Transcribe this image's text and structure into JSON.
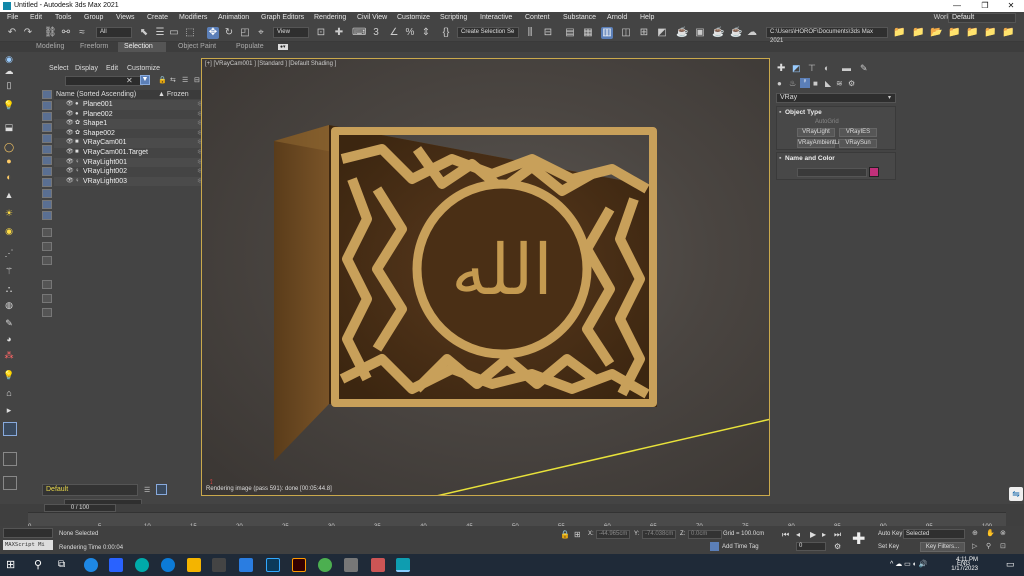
{
  "window": {
    "title": "Untitled - Autodesk 3ds Max 2021",
    "minimize": "—",
    "restore": "❐",
    "close": "✕"
  },
  "menu": [
    "File",
    "Edit",
    "Tools",
    "Group",
    "Views",
    "Create",
    "Modifiers",
    "Animation",
    "Graph Editors",
    "Rendering",
    "Civil View",
    "Customize",
    "Scripting",
    "Interactive",
    "Content",
    "Substance",
    "Arnold",
    "Help"
  ],
  "workspaces": {
    "label": "Workspaces:",
    "value": "Default"
  },
  "toolbar": {
    "filter": "All",
    "refcoord": "View",
    "selset": "Create Selection Se",
    "path": "C:\\Users\\HOROF\\Documents\\3ds Max 2021"
  },
  "ribbon": [
    "Modeling",
    "Freeform",
    "Selection",
    "Object Paint",
    "Populate"
  ],
  "scene": {
    "tabs": [
      "Select",
      "Display",
      "Edit",
      "Customize"
    ],
    "col_name": "Name (Sorted Ascending)",
    "col_frozen": "▲ Frozen",
    "rows": [
      "Plane001",
      "Plane002",
      "Shape1",
      "Shape002",
      "VRayCam001",
      "VRayCam001.Target",
      "VRayLight001",
      "VRayLight002",
      "VRayLight003"
    ],
    "layer": "Default"
  },
  "viewport": {
    "label": "[+] [VRayCam001 ] [Standard ] [Default Shading ]",
    "status": "Rendering image (pass 591): done [00:05:44.8]",
    "calligraphy": "الله"
  },
  "cmd": {
    "renderer": "VRay",
    "object_type": "Object Type",
    "autogrid": "AutoGrid",
    "buttons": [
      "VRayLight",
      "VRayIES",
      "VRayAmbientLig",
      "VRaySun"
    ],
    "name_color": "Name and Color",
    "swatch": "#c0307a"
  },
  "timeline": {
    "frame": "0 / 100",
    "ticks": [
      "0",
      "5",
      "10",
      "15",
      "20",
      "25",
      "30",
      "35",
      "40",
      "45",
      "50",
      "55",
      "60",
      "65",
      "70",
      "75",
      "80",
      "85",
      "90",
      "95",
      "100"
    ]
  },
  "status": {
    "maxscript": "MAXScript Mi",
    "selected": "None Selected",
    "render_time": "Rendering Time  0:00:04",
    "x": "-44.965cm",
    "y": "-74.038cm",
    "z": "0.0cm",
    "grid": "Grid = 100.0cm",
    "add_time_tag": "Add Time Tag",
    "auto_key": "Auto Key",
    "set_key": "Set Key",
    "selected_dd": "Selected",
    "key_filters": "Key Filters...",
    "frame_val": "0"
  },
  "taskbar": {
    "time": "4:11 PM",
    "date": "1/17/2023",
    "lang": "ENG"
  }
}
